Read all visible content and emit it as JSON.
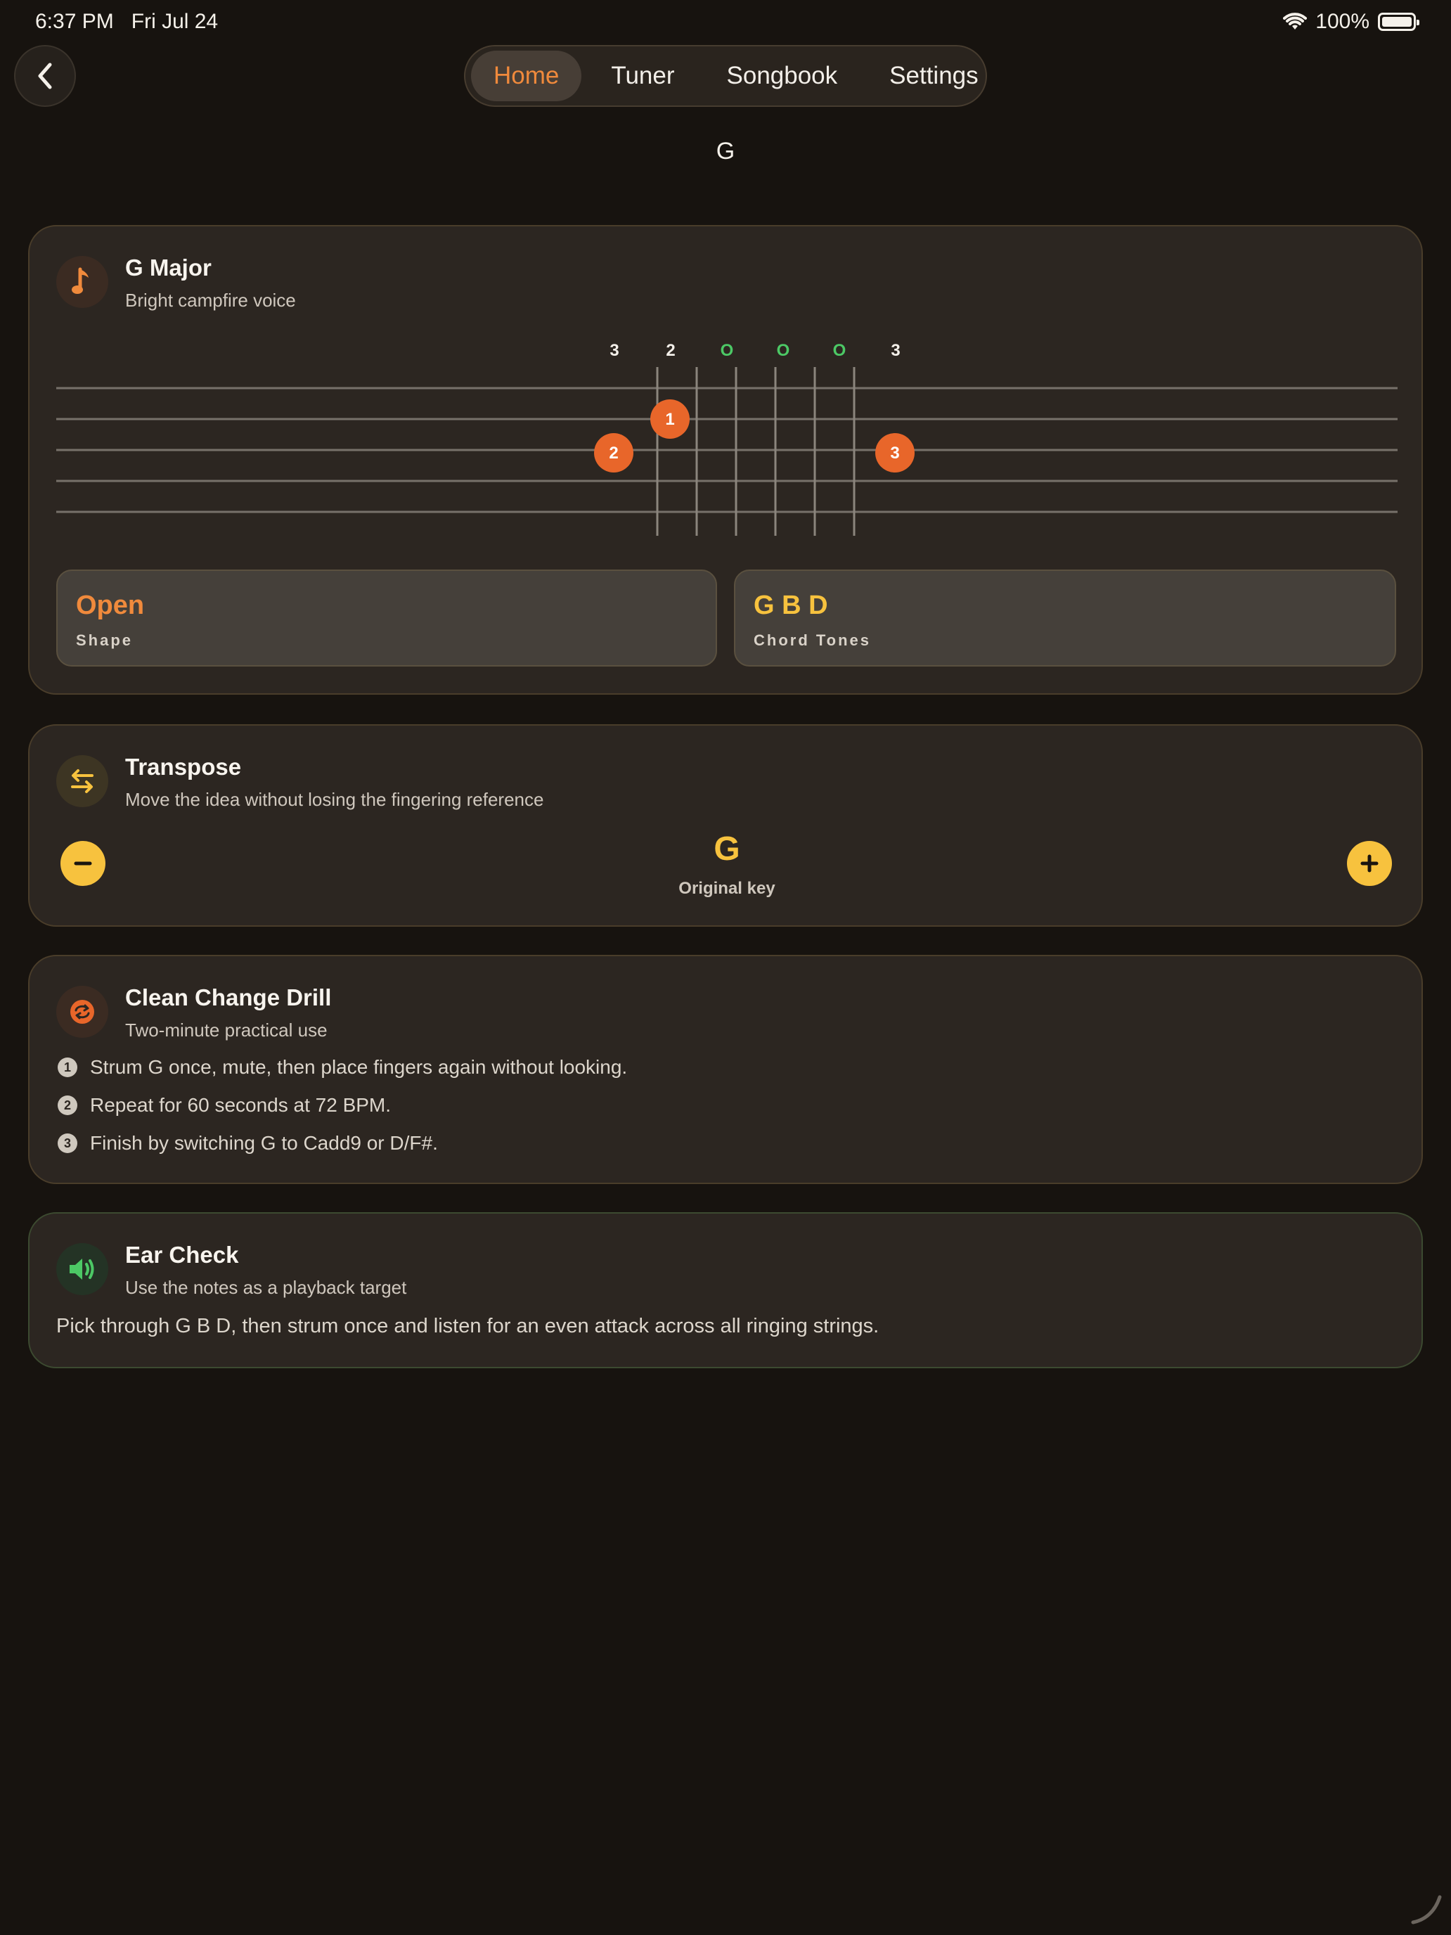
{
  "status_bar": {
    "time": "6:37 PM",
    "date": "Fri Jul 24",
    "battery": "100%"
  },
  "nav": {
    "back_icon": "chevron-left-icon",
    "tabs": [
      {
        "label": "Home",
        "active": true
      },
      {
        "label": "Tuner",
        "active": false
      },
      {
        "label": "Songbook",
        "active": false
      },
      {
        "label": "Settings",
        "active": false
      }
    ]
  },
  "page_title": "G",
  "chord_card": {
    "icon": "music-note-icon",
    "title": "G Major",
    "subtitle": "Bright campfire voice",
    "string_markers": [
      "3",
      "2",
      "O",
      "O",
      "O",
      "3"
    ],
    "finger_dots": [
      {
        "finger": "1",
        "string": 2,
        "fret": 1
      },
      {
        "finger": "2",
        "string": 1,
        "fret": 2
      },
      {
        "finger": "3",
        "string": 6,
        "fret": 2
      }
    ],
    "shape_value": "Open",
    "shape_label": "Shape",
    "tones_value": "G B D",
    "tones_label": "Chord Tones"
  },
  "transpose_card": {
    "icon": "swap-arrows-icon",
    "title": "Transpose",
    "subtitle": "Move the idea without losing the fingering reference",
    "key": "G",
    "key_label": "Original key",
    "minus_icon": "minus-icon",
    "plus_icon": "plus-icon"
  },
  "drill_card": {
    "icon": "repeat-icon",
    "title": "Clean Change Drill",
    "subtitle": "Two-minute practical use",
    "steps": [
      {
        "num": "1",
        "text": "Strum G once, mute, then place fingers again without looking."
      },
      {
        "num": "2",
        "text": "Repeat for 60 seconds at 72 BPM."
      },
      {
        "num": "3",
        "text": "Finish by switching G to Cadd9 or D/F#."
      }
    ]
  },
  "ear_card": {
    "icon": "speaker-icon",
    "title": "Ear Check",
    "subtitle": "Use the notes as a playback target",
    "body": "Pick through G B D, then strum once and listen for an even attack across all ringing strings."
  },
  "colors": {
    "accent_orange": "#f08a3c",
    "accent_yellow": "#f7c23e",
    "accent_green": "#4cc865",
    "background": "#17130f",
    "card": "#2c2621"
  }
}
